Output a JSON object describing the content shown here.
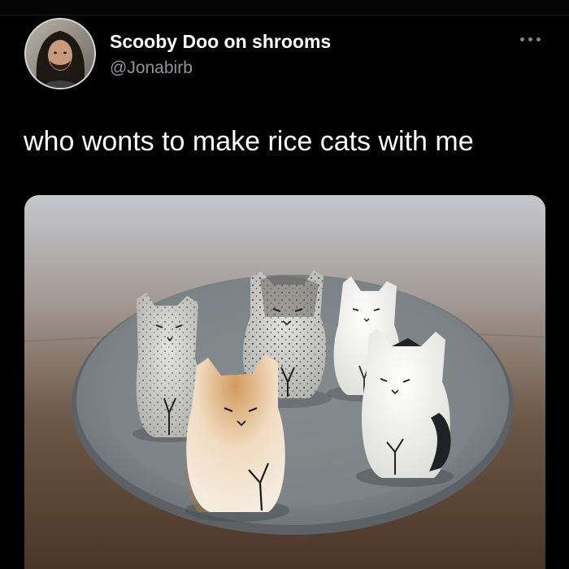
{
  "tweet": {
    "display_name": "Scooby Doo on shrooms",
    "handle": "@Jonabirb",
    "text": "who wonts to make rice cats with me"
  },
  "icons": {
    "more": "more-horizontal-icon",
    "avatar": "profile-avatar"
  },
  "media": {
    "subject": "five rice-ball cat sculptures on a grey plate"
  },
  "colors": {
    "background": "#000000",
    "name": "#ffffff",
    "handle": "#8f969b",
    "text": "#ffffff"
  }
}
